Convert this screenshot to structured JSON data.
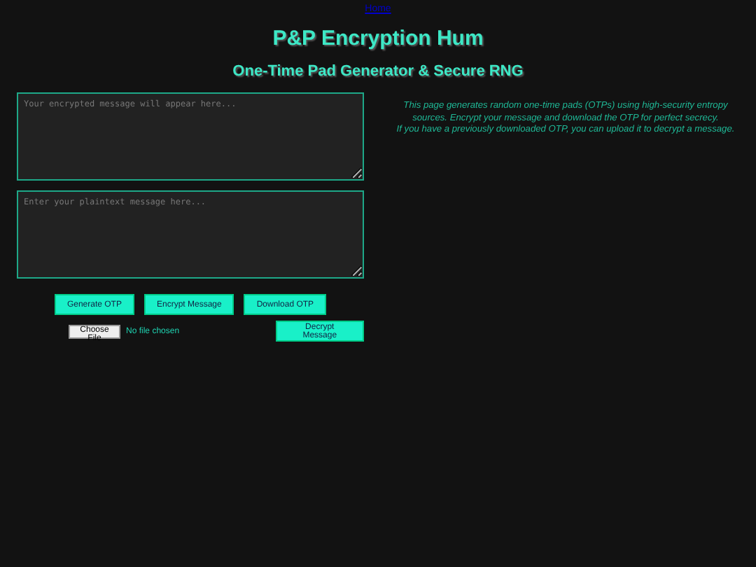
{
  "nav": {
    "link": "Home"
  },
  "header": {
    "title": "P&P Encryption Hum",
    "subtitle": "One-Time Pad Generator & Secure RNG"
  },
  "fields": [
    {
      "placeholder": "Your encrypted message will appear here..."
    },
    {
      "placeholder": "Enter your plaintext message here..."
    }
  ],
  "buttons": [
    "Generate OTP",
    "Encrypt Message",
    "Download OTP"
  ],
  "file_input": {
    "button": "Choose File",
    "status": "No file chosen"
  },
  "decrypt_button": "Decrypt Message",
  "info": [
    "This page generates random one-time pads (OTPs) using high-security entropy sources. Encrypt your message and download the OTP for perfect secrecy.",
    "If you have a previously downloaded OTP, you can upload it to decrypt a message."
  ]
}
